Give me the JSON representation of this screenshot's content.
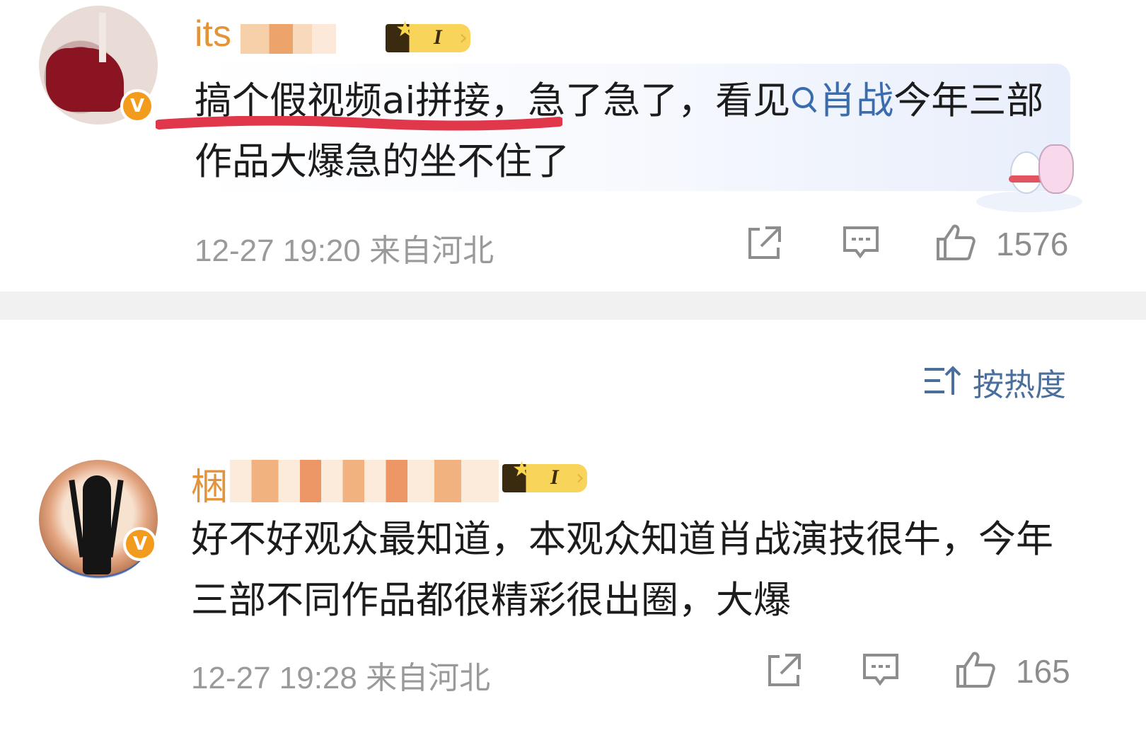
{
  "comments": [
    {
      "username": "its",
      "level": "I",
      "text_before_link": "搞个假视频ai拼接，急了急了，看见",
      "link_text": "肖战",
      "text_after_link": "今年三部作品大爆急的坐不住了",
      "time": "12-27 19:20",
      "location": "来自河北",
      "likes": "1576"
    },
    {
      "username": "梱",
      "level": "I",
      "text": "好不好观众最知道，本观众知道肖战演技很牛，今年三部不同作品都很精彩很出圈，大爆",
      "time": "12-27 19:28",
      "location": "来自河北",
      "likes": "165"
    }
  ],
  "sort": {
    "label": "按热度"
  },
  "colors": {
    "username": "#e59339",
    "link": "#3b6cae",
    "meta": "#9a9a9a",
    "sort": "#4b6f9d",
    "badge": "#f29b1c",
    "underline": "#e0384a"
  },
  "icons": [
    "verified-v-icon",
    "crown-level-icon",
    "search-icon",
    "share-icon",
    "comment-icon",
    "like-icon",
    "sort-icon"
  ]
}
